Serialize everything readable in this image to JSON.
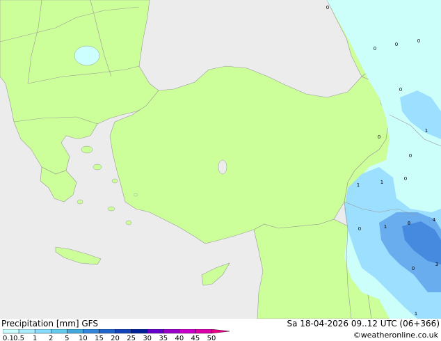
{
  "map": {
    "colors": {
      "sea": "#ececec",
      "land": "#ccff99",
      "precip_light": "#ccffff",
      "precip_mid": "#99ddff",
      "precip_heavy": "#66aaee",
      "precip_vheavy": "#4488dd",
      "border": "#999999"
    },
    "point_labels": [
      {
        "text": "0"
      },
      {
        "text": "0"
      },
      {
        "text": "0"
      },
      {
        "text": "0"
      },
      {
        "text": "0"
      },
      {
        "text": "1"
      },
      {
        "text": "0"
      },
      {
        "text": "0"
      },
      {
        "text": "1"
      },
      {
        "text": "1"
      },
      {
        "text": "0"
      },
      {
        "text": "1"
      },
      {
        "text": "8"
      },
      {
        "text": "4"
      },
      {
        "text": "0"
      },
      {
        "text": "3"
      },
      {
        "text": "1"
      },
      {
        "text": "0"
      }
    ]
  },
  "legend": {
    "title": "Precipitation [mm]  GFS",
    "datetime": "Sa 18-04-2026 09..12 UTC (06+366)",
    "credit": "©weatheronline.co.uk",
    "scale": [
      {
        "label": "0.1",
        "color": "#ccffff"
      },
      {
        "label": "0.5",
        "color": "#aaeeff"
      },
      {
        "label": "1",
        "color": "#88ddff"
      },
      {
        "label": "2",
        "color": "#66ccee"
      },
      {
        "label": "5",
        "color": "#44aadd"
      },
      {
        "label": "10",
        "color": "#3388dd"
      },
      {
        "label": "15",
        "color": "#2266cc"
      },
      {
        "label": "20",
        "color": "#1144bb"
      },
      {
        "label": "25",
        "color": "#002299"
      },
      {
        "label": "30",
        "color": "#6600cc"
      },
      {
        "label": "35",
        "color": "#9900cc"
      },
      {
        "label": "40",
        "color": "#cc00cc"
      },
      {
        "label": "45",
        "color": "#dd00aa"
      },
      {
        "label": "50",
        "color": "#ee0088"
      }
    ]
  }
}
